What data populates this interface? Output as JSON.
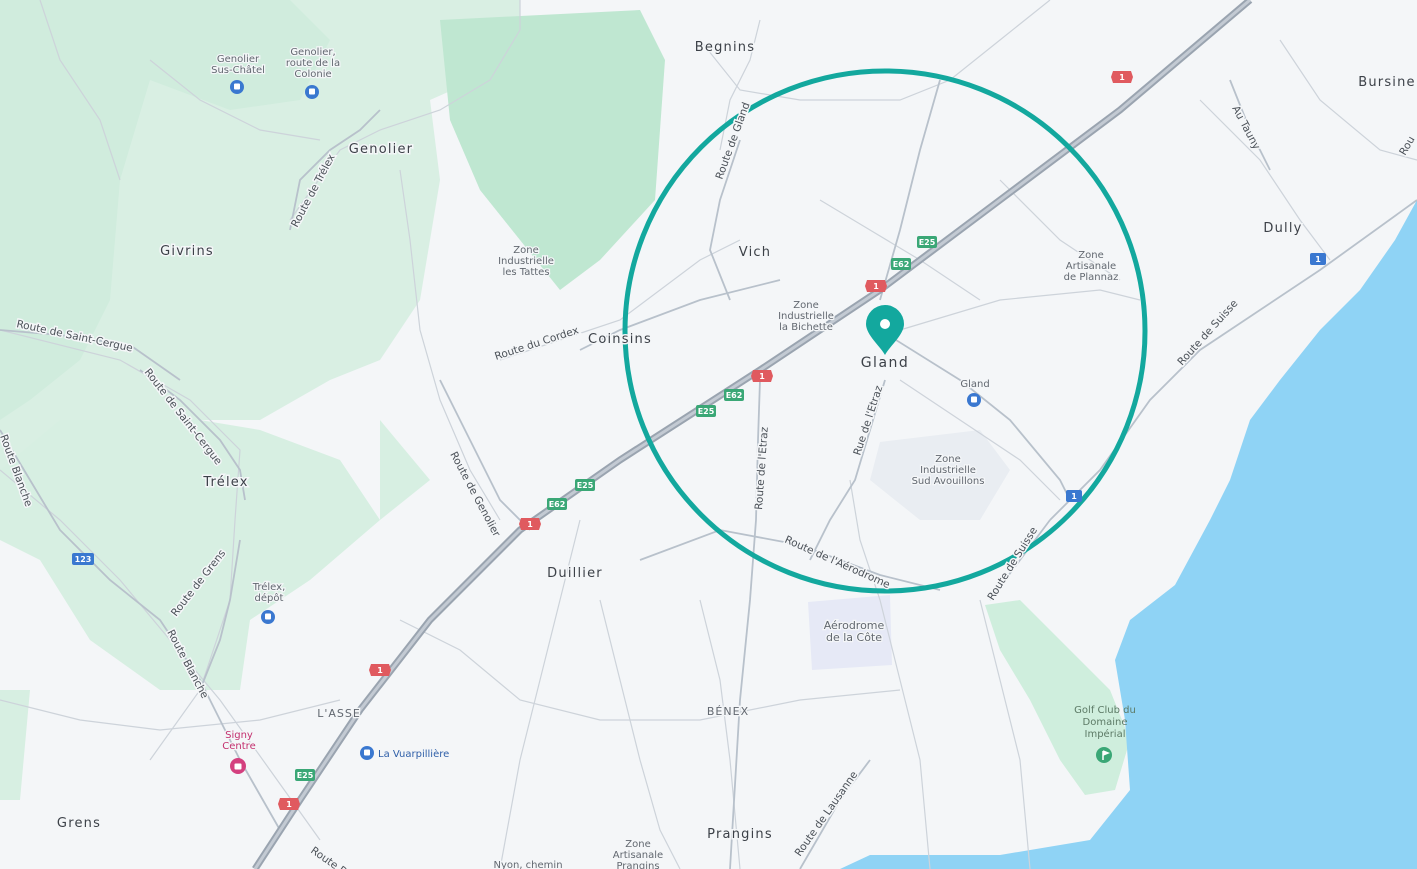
{
  "map": {
    "colors": {
      "land": "#f4f6f8",
      "forest": "#cfeadb",
      "forest_dark": "#b5e1c8",
      "water": "#8fd3f5",
      "road_major": "#aeb7c2",
      "road_minor": "#c9d0d8",
      "highway": "#a7b0bb",
      "radius_circle": "#13a89e",
      "marker": "#13a89e",
      "shield_red": "#e05a5f",
      "shield_green": "#3aa776",
      "shield_blue": "#3a78d0"
    },
    "places": {
      "gland": "Gland",
      "begnins": "Begnins",
      "bursine": "Bursine",
      "genolier": "Genolier",
      "givrins": "Givrins",
      "vich": "Vich",
      "coinsins": "Coinsins",
      "dully": "Dully",
      "trelex": "Trélex",
      "duillier": "Duillier",
      "lasse": "L'ASSE",
      "benex": "BÉNEX",
      "prangins": "Prangins",
      "grens": "Grens"
    },
    "roads": {
      "route_de_gland": "Route de Gland",
      "route_de_trelex": "Route de Trélex",
      "route_de_saint_cergue_w": "Route de Saint-Cergue",
      "route_de_saint_cergue": "Route de Saint-Cergue",
      "route_du_cordex": "Route du Cordex",
      "route_de_genolier": "Route de Genolier",
      "route_de_letraz": "Route de l'Etraz",
      "rue_de_letraz": "Rue de l'Etraz",
      "route_de_laerodrome": "Route de l'Aérodrome",
      "route_de_suisse": "Route de Suisse",
      "route_de_suisse_s": "Route de Suisse",
      "au_tauny": "Au Tauny",
      "route_de_grens": "Route de Grens",
      "route_blanche": "Route Blanche",
      "route_blanche_w": "Route Blanche",
      "route_de_lausanne": "Route de Lausanne",
      "route_d": "Route D",
      "route_e": "Rou"
    },
    "pois": {
      "zone_tattes": [
        "Zone",
        "Industrielle",
        "les Tattes"
      ],
      "zone_bichette": [
        "Zone",
        "Industrielle",
        "la Bichette"
      ],
      "zone_plannaz": [
        "Zone",
        "Artisanale",
        "de Plannaz"
      ],
      "zone_avouillons": [
        "Zone",
        "Industrielle",
        "Sud Avouillons"
      ],
      "aerodrome": [
        "Aérodrome",
        "de la Côte"
      ],
      "golf": [
        "Golf Club du",
        "Domaine",
        "Impérial"
      ],
      "zone_prangins": [
        "Zone",
        "Artisanale",
        "Prangins"
      ],
      "signy": [
        "Signy",
        "Centre"
      ],
      "nyon_chemin": "Nyon, chemin"
    },
    "stops": {
      "genolier_sus_chatel": [
        "Genolier",
        "Sus-Châtel"
      ],
      "genolier_colonie": [
        "Genolier,",
        "route de la",
        "Colonie"
      ],
      "gland_station": "Gland",
      "trelex_depot": [
        "Trélex,",
        "dépôt"
      ],
      "la_vuarpilliere": "La Vuarpillière"
    },
    "shields": {
      "a1": "1",
      "e62": "E62",
      "e25": "E25",
      "r1": "1",
      "r123": "123"
    },
    "marker_icon": "map-pin-icon",
    "golf_icon": "golf-flag-icon",
    "stop_icon": "bus-stop-icon",
    "shopping_icon": "shopping-bag-icon"
  }
}
